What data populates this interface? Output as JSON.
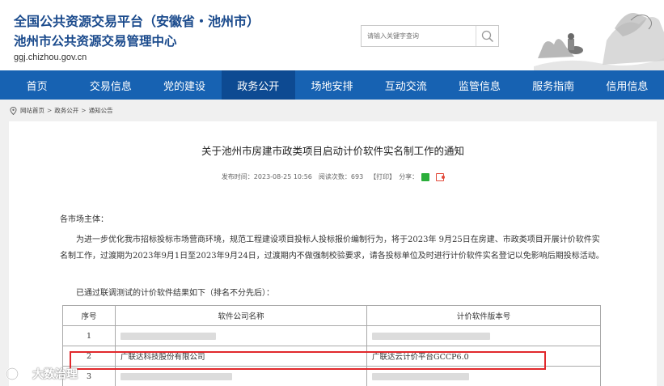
{
  "header": {
    "title_line1": "全国公共资源交易平台（安徽省・池州市）",
    "title_line2": "池州市公共资源交易管理中心",
    "domain": "ggj.chizhou.gov.cn",
    "search_placeholder": "请输入关键字查询"
  },
  "nav": {
    "items": [
      "首页",
      "交易信息",
      "党的建设",
      "政务公开",
      "场地安排",
      "互动交流",
      "监管信息",
      "服务指南",
      "信用信息"
    ],
    "active_index": 3
  },
  "breadcrumb": [
    "网站首页",
    "政务公开",
    "通知公告"
  ],
  "article": {
    "title": "关于池州市房建市政类项目启动计价软件实名制工作的通知",
    "publish_label": "发布时间：2023-08-25 10:56",
    "views_label": "阅读次数：693",
    "print_label": "【打印】",
    "share_label": "分享：",
    "salutation": "各市场主体：",
    "paragraph": "为进一步优化我市招标投标市场营商环境，规范工程建设项目投标人投标报价编制行为，将于2023年 9月25日在房建、市政类项目开展计价软件实名制工作，过渡期为2023年9月1日至2023年9月24日，过渡期内不做强制校验要求，请各投标单位及时进行计价软件实名登记以免影响后期投标活动。",
    "list_intro": "已通过联调测试的计价软件结果如下（排名不分先后）："
  },
  "table": {
    "headers": [
      "序号",
      "软件公司名称",
      "计价软件版本号"
    ],
    "rows": [
      {
        "no": "1",
        "company": "",
        "version": ""
      },
      {
        "no": "2",
        "company": "广联达科技股份有限公司",
        "version": "广联达云计价平台GCCP6.0"
      },
      {
        "no": "3",
        "company": "",
        "version": ""
      }
    ]
  },
  "watermark": "大数治理",
  "colors": {
    "primary": "#1762b2",
    "nav_active": "#0d4a92",
    "title": "#1a4a8c",
    "highlight": "#e1282c"
  }
}
